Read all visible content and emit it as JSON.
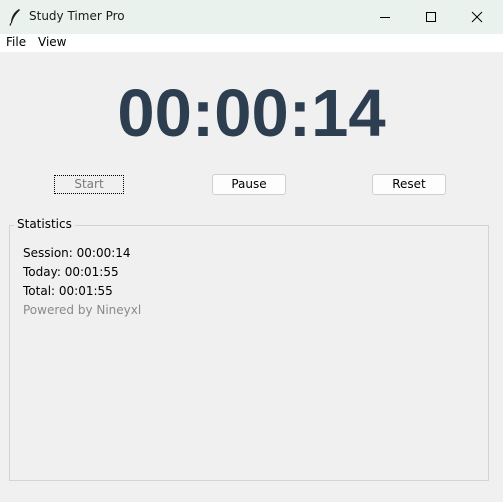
{
  "window": {
    "title": "Study Timer Pro",
    "icon": "feather-icon",
    "controls": [
      "minimize-icon",
      "maximize-icon",
      "close-icon"
    ]
  },
  "menu": {
    "file": "File",
    "view": "View"
  },
  "timer": {
    "display": "00:00:14",
    "color": "#2c3e50"
  },
  "buttons": {
    "start": "Start",
    "pause": "Pause",
    "reset": "Reset"
  },
  "statistics": {
    "title": "Statistics",
    "session": "Session: 00:00:14",
    "today": "Today: 00:01:55",
    "total": "Total: 00:01:55",
    "powered_by": "Powered by Nineyxl"
  }
}
